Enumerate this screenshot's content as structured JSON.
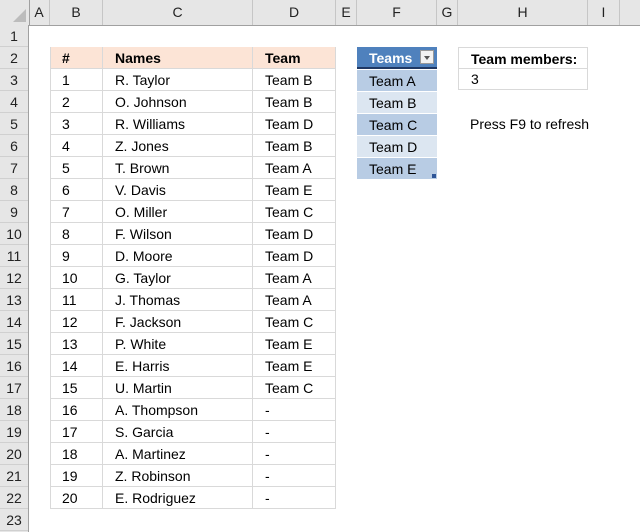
{
  "columns": [
    "A",
    "B",
    "C",
    "D",
    "E",
    "F",
    "G",
    "H",
    "I"
  ],
  "rows": [
    "1",
    "2",
    "3",
    "4",
    "5",
    "6",
    "7",
    "8",
    "9",
    "10",
    "11",
    "12",
    "13",
    "14",
    "15",
    "16",
    "17",
    "18",
    "19",
    "20",
    "21",
    "22",
    "23"
  ],
  "main_table": {
    "headers": {
      "num": "#",
      "name": "Names",
      "team": "Team"
    },
    "rows": [
      {
        "num": "1",
        "name": "R. Taylor",
        "team": "Team B"
      },
      {
        "num": "2",
        "name": "O. Johnson",
        "team": "Team B"
      },
      {
        "num": "3",
        "name": "R. Williams",
        "team": "Team D"
      },
      {
        "num": "4",
        "name": "Z. Jones",
        "team": "Team B"
      },
      {
        "num": "5",
        "name": "T. Brown",
        "team": "Team A"
      },
      {
        "num": "6",
        "name": "V. Davis",
        "team": "Team E"
      },
      {
        "num": "7",
        "name": "O. Miller",
        "team": "Team C"
      },
      {
        "num": "8",
        "name": "F. Wilson",
        "team": "Team D"
      },
      {
        "num": "9",
        "name": "D. Moore",
        "team": "Team D"
      },
      {
        "num": "10",
        "name": "G. Taylor",
        "team": "Team A"
      },
      {
        "num": "11",
        "name": "J. Thomas",
        "team": "Team A"
      },
      {
        "num": "12",
        "name": "F. Jackson",
        "team": "Team C"
      },
      {
        "num": "13",
        "name": "P. White",
        "team": "Team E"
      },
      {
        "num": "14",
        "name": "E. Harris",
        "team": "Team E"
      },
      {
        "num": "15",
        "name": "U. Martin",
        "team": "Team C"
      },
      {
        "num": "16",
        "name": "A. Thompson",
        "team": "-"
      },
      {
        "num": "17",
        "name": "S. Garcia",
        "team": "-"
      },
      {
        "num": "18",
        "name": "A. Martinez",
        "team": "-"
      },
      {
        "num": "19",
        "name": "Z. Robinson",
        "team": "-"
      },
      {
        "num": "20",
        "name": "E. Rodriguez",
        "team": "-"
      }
    ]
  },
  "teams_table": {
    "header": "Teams",
    "items": [
      "Team A",
      "Team B",
      "Team C",
      "Team D",
      "Team E"
    ]
  },
  "team_members": {
    "label": "Team members:",
    "value": "3"
  },
  "note": "Press F9 to refresh",
  "colors": {
    "header_fill": "#fce4d6",
    "teams_header": "#4f81bd",
    "band_dark": "#b8cce4",
    "band_light": "#dce6f1"
  }
}
